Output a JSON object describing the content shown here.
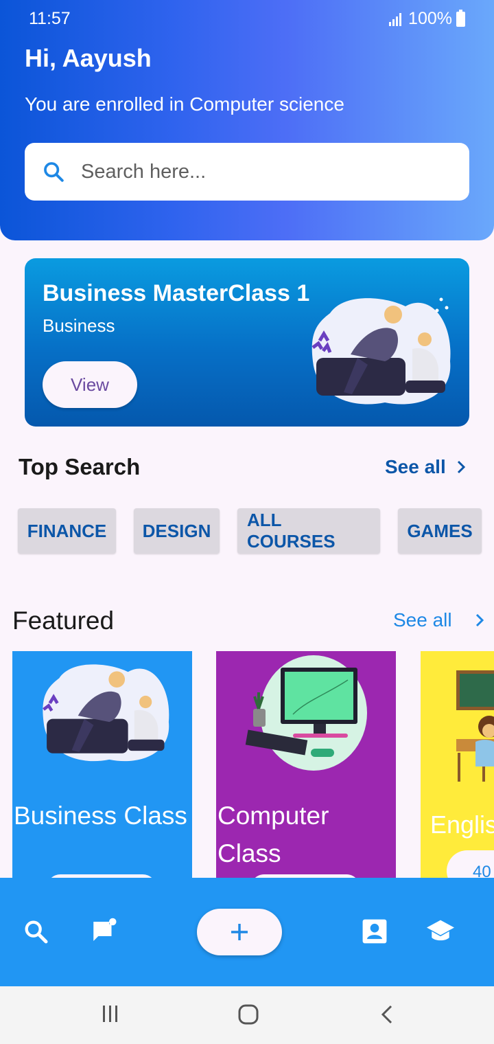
{
  "status_bar": {
    "time": "11:57",
    "battery": "100%"
  },
  "header": {
    "greeting": "Hi, Aayush",
    "subtitle": "You are enrolled in Computer science",
    "search_placeholder": "Search here..."
  },
  "promo": {
    "title": "Business MasterClass 1",
    "category": "Business",
    "button_label": "View",
    "background": "#0570c6"
  },
  "top_search": {
    "title": "Top Search",
    "see_all": "See all",
    "chips": [
      "FINANCE",
      "DESIGN",
      "ALL COURSES",
      "GAMES"
    ]
  },
  "featured": {
    "title": "Featured",
    "see_all": "See all",
    "courses": [
      {
        "title": "Business Class",
        "color": "#2196f3"
      },
      {
        "title": "Computer Class",
        "color": "#9c27b0"
      },
      {
        "title": "English Class",
        "color": "#ffeb3b",
        "badge_partial": "40"
      }
    ]
  },
  "bottom_nav": {
    "items": [
      "search-icon",
      "chat-icon",
      "add-icon",
      "profile-icon",
      "school-icon"
    ],
    "color": "#2196f3"
  },
  "system_nav": [
    "recents-icon",
    "home-icon",
    "back-icon"
  ]
}
